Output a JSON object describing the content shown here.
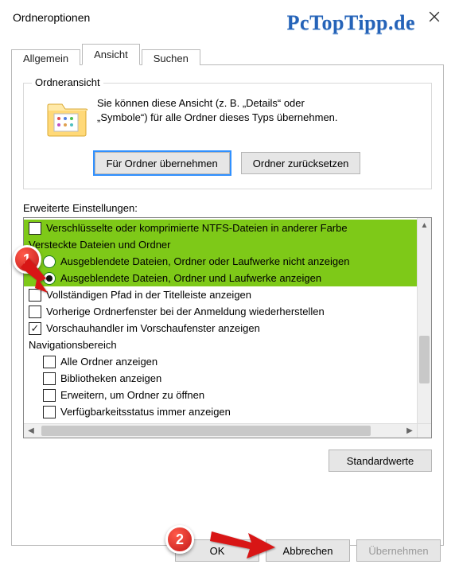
{
  "window": {
    "title": "Ordneroptionen"
  },
  "watermark": "PcTopTipp.de",
  "tabs": {
    "general": "Allgemein",
    "view": "Ansicht",
    "search": "Suchen",
    "active": "view"
  },
  "group": {
    "label": "Ordneransicht",
    "desc_line1": "Sie können diese Ansicht (z. B. „Details“ oder",
    "desc_line2": "„Symbole“) für alle Ordner dieses Typs übernehmen.",
    "apply_btn": "Für Ordner übernehmen",
    "reset_btn": "Ordner zurücksetzen"
  },
  "advanced": {
    "label": "Erweiterte Einstellungen:",
    "items": [
      {
        "type": "check",
        "checked": false,
        "label": "Verschlüsselte oder komprimierte NTFS-Dateien in anderer Farbe",
        "hl": true,
        "indent": 0
      },
      {
        "type": "header",
        "label": "Versteckte Dateien und Ordner",
        "hl": true
      },
      {
        "type": "radio",
        "selected": false,
        "label": "Ausgeblendete Dateien, Ordner oder Laufwerke nicht anzeigen",
        "hl": true,
        "indent": 1
      },
      {
        "type": "radio",
        "selected": true,
        "label": "Ausgeblendete Dateien, Ordner und Laufwerke anzeigen",
        "hl": true,
        "indent": 1
      },
      {
        "type": "check",
        "checked": false,
        "label": "Vollständigen Pfad in der Titelleiste anzeigen",
        "indent": 0
      },
      {
        "type": "check",
        "checked": false,
        "label": "Vorherige Ordnerfenster bei der Anmeldung wiederherstellen",
        "indent": 0
      },
      {
        "type": "check",
        "checked": true,
        "label": "Vorschauhandler im Vorschaufenster anzeigen",
        "indent": 0
      },
      {
        "type": "header",
        "label": "Navigationsbereich"
      },
      {
        "type": "check",
        "checked": false,
        "label": "Alle Ordner anzeigen",
        "indent": 1
      },
      {
        "type": "check",
        "checked": false,
        "label": "Bibliotheken anzeigen",
        "indent": 1
      },
      {
        "type": "check",
        "checked": false,
        "label": "Erweitern, um Ordner zu öffnen",
        "indent": 1
      },
      {
        "type": "check",
        "checked": false,
        "label": "Verfügbarkeitsstatus immer anzeigen",
        "indent": 1
      }
    ],
    "defaults_btn": "Standardwerte"
  },
  "buttons": {
    "ok": "OK",
    "cancel": "Abbrechen",
    "apply": "Übernehmen"
  },
  "annotations": {
    "badge1": "1",
    "badge2": "2"
  }
}
